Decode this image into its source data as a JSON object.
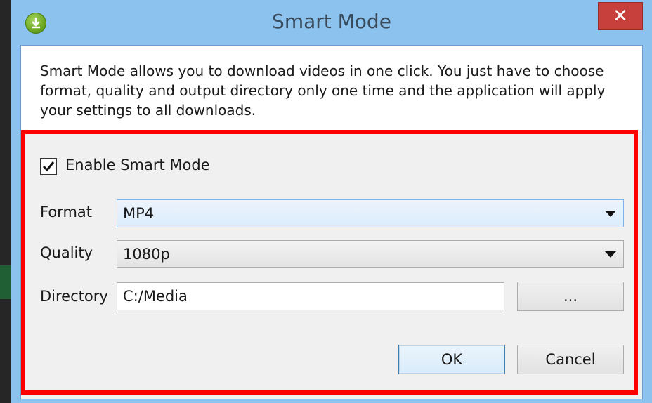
{
  "window": {
    "title": "Smart Mode",
    "close_glyph": "✕"
  },
  "description": "Smart Mode allows you to download videos in one click. You just have to choose format, quality and output directory only one time and the application will apply your settings to all downloads.",
  "settings": {
    "enable_label": "Enable Smart Mode",
    "enabled": true,
    "format_label": "Format",
    "format_value": "MP4",
    "quality_label": "Quality",
    "quality_value": "1080p",
    "directory_label": "Directory",
    "directory_value": "C:/Media",
    "browse_label": "..."
  },
  "actions": {
    "ok_label": "OK",
    "cancel_label": "Cancel"
  },
  "colors": {
    "highlight": "#ff0000",
    "frame": "#8cc2ee",
    "close": "#c7403b"
  },
  "icons": [
    "app-logo-icon",
    "close-icon",
    "checkmark-icon",
    "chevron-down-icon"
  ]
}
